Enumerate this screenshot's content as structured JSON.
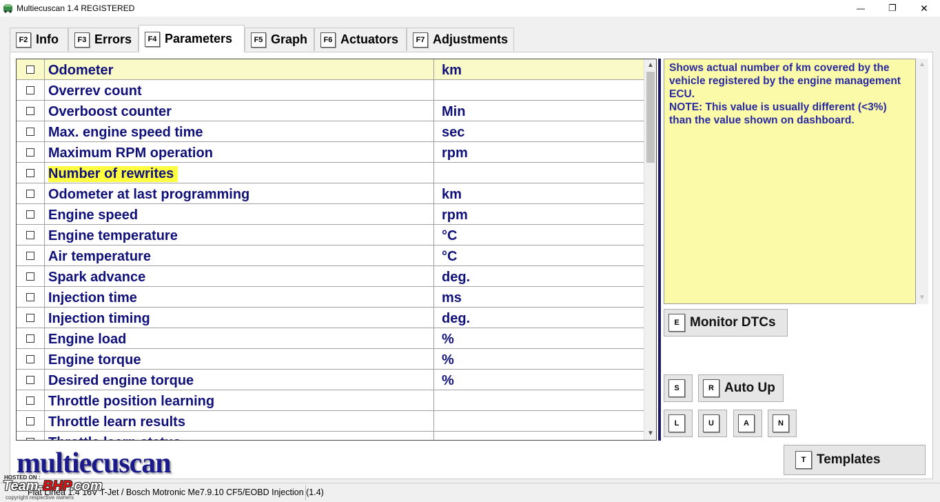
{
  "window": {
    "title": "Multiecuscan 1.4 REGISTERED",
    "minimize_glyph": "—",
    "maximize_glyph": "❐",
    "close_glyph": "✕"
  },
  "tabs": [
    {
      "key": "F2",
      "label": "Info"
    },
    {
      "key": "F3",
      "label": "Errors"
    },
    {
      "key": "F4",
      "label": "Parameters",
      "active": true
    },
    {
      "key": "F5",
      "label": "Graph"
    },
    {
      "key": "F6",
      "label": "Actuators"
    },
    {
      "key": "F7",
      "label": "Adjustments"
    }
  ],
  "parameters": [
    {
      "name": "Odometer",
      "unit": "km",
      "selected": true
    },
    {
      "name": "Overrev count",
      "unit": ""
    },
    {
      "name": "Overboost counter",
      "unit": "Min"
    },
    {
      "name": "Max. engine speed time",
      "unit": "sec"
    },
    {
      "name": "Maximum RPM operation",
      "unit": "rpm"
    },
    {
      "name": "Number of rewrites",
      "unit": "",
      "highlighted": true
    },
    {
      "name": "Odometer at last programming",
      "unit": "km"
    },
    {
      "name": "Engine speed",
      "unit": "rpm"
    },
    {
      "name": "Engine temperature",
      "unit": "°C"
    },
    {
      "name": "Air temperature",
      "unit": "°C"
    },
    {
      "name": "Spark advance",
      "unit": "deg."
    },
    {
      "name": "Injection time",
      "unit": "ms"
    },
    {
      "name": "Injection timing",
      "unit": "deg."
    },
    {
      "name": "Engine load",
      "unit": "%"
    },
    {
      "name": "Engine torque",
      "unit": "%"
    },
    {
      "name": "Desired engine torque",
      "unit": "%"
    },
    {
      "name": "Throttle position learning",
      "unit": ""
    },
    {
      "name": "Throttle learn results",
      "unit": ""
    },
    {
      "name": "Throttle learn status",
      "unit": ""
    }
  ],
  "description": {
    "line1": "Shows actual number of km covered by the vehicle registered by the engine management ECU.",
    "line2": "NOTE: This value is usually different (<3%) than the value shown on dashboard."
  },
  "buttons": {
    "monitor_dtcs": {
      "key": "E",
      "label": "Monitor DTCs"
    },
    "s": {
      "key": "S"
    },
    "auto_up": {
      "key": "R",
      "label": "Auto Up"
    },
    "l": {
      "key": "L"
    },
    "u": {
      "key": "U"
    },
    "a": {
      "key": "A"
    },
    "n": {
      "key": "N"
    },
    "templates": {
      "key": "T",
      "label": "Templates"
    }
  },
  "logo": "multiecuscan",
  "status": "Fiat Linea 1.4 16V T-Jet / Bosch Motronic Me7.9.10 CF5/EOBD Injection (1.4)",
  "watermark": {
    "top": "HOSTED ON :",
    "main_a": "Team-",
    "main_b": "BHP",
    "main_c": ".com",
    "sub": "copyright respective owners"
  },
  "colors": {
    "param_text": "#10107a",
    "selected_row": "#fafac8",
    "highlight": "#ffff40",
    "description_bg": "#fafaa8"
  }
}
